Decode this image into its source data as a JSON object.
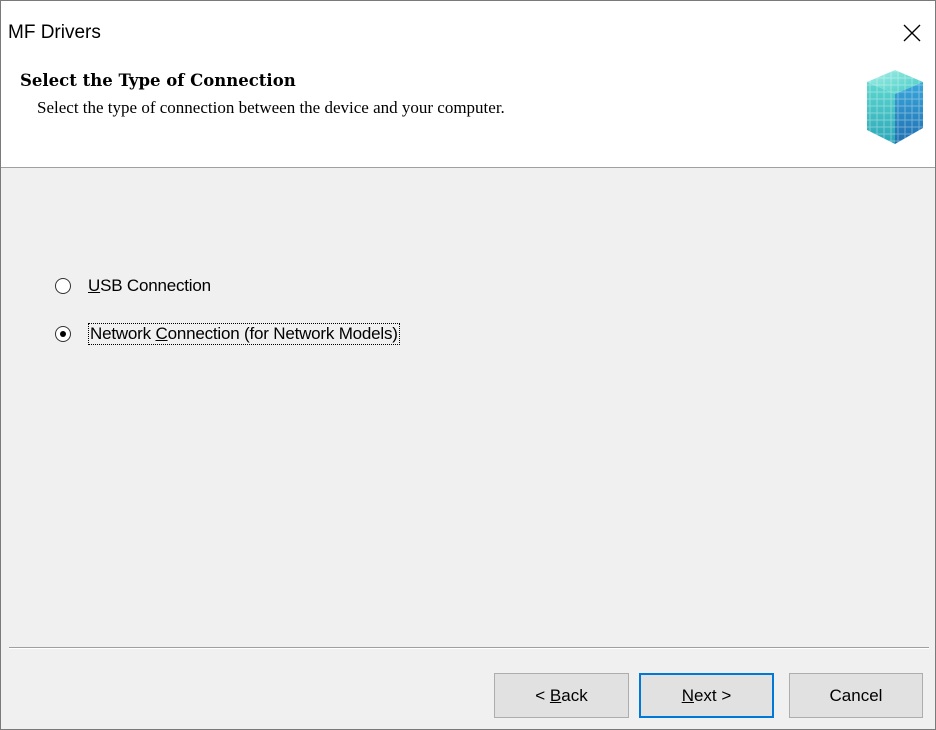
{
  "window": {
    "title": "MF Drivers"
  },
  "header": {
    "title": "Select the Type of Connection",
    "subtitle": "Select the type of connection between the device and your computer."
  },
  "options": [
    {
      "prefix": "",
      "accel": "U",
      "rest": "SB Connection",
      "checked": false
    },
    {
      "prefix": "Network ",
      "accel": "C",
      "rest": "onnection (for Network Models)",
      "checked": true
    }
  ],
  "buttons": {
    "back": {
      "prefix": "< ",
      "accel": "B",
      "rest": "ack"
    },
    "next": {
      "prefix": "",
      "accel": "N",
      "rest": "ext >"
    },
    "cancel": "Cancel"
  },
  "colors": {
    "logo_teal": "#3ec9c2",
    "logo_blue": "#2a9fd8",
    "focus_border": "#0078d7"
  }
}
